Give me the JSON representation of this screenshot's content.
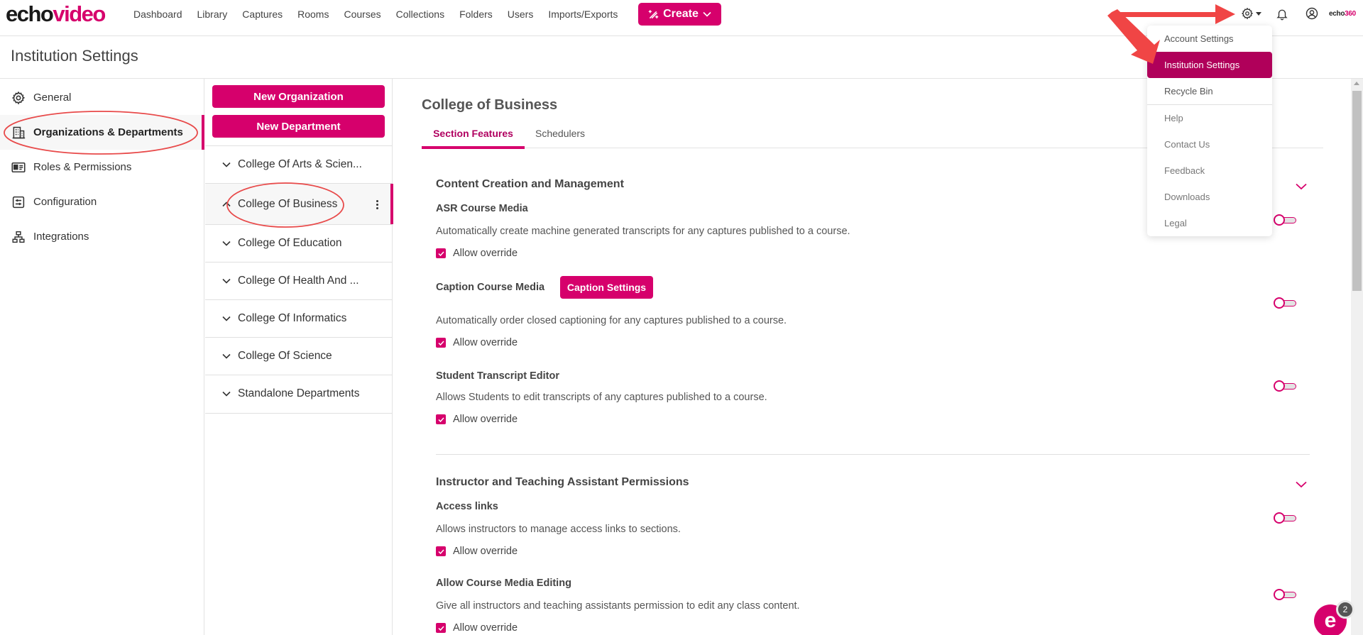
{
  "header": {
    "logo": {
      "part1": "echo",
      "part2": "video"
    },
    "nav": [
      "Dashboard",
      "Library",
      "Captures",
      "Rooms",
      "Courses",
      "Collections",
      "Folders",
      "Users",
      "Imports/Exports"
    ],
    "create_label": "Create",
    "brand_small": {
      "part1": "echo",
      "part2": "360"
    }
  },
  "page": {
    "title": "Institution Settings"
  },
  "sidebar": {
    "items": [
      {
        "label": "General",
        "icon": "gear-icon"
      },
      {
        "label": "Organizations & Departments",
        "icon": "building-icon",
        "active": true
      },
      {
        "label": "Roles & Permissions",
        "icon": "id-card-icon"
      },
      {
        "label": "Configuration",
        "icon": "configuration-icon"
      },
      {
        "label": "Integrations",
        "icon": "network-icon"
      }
    ]
  },
  "orgtree": {
    "new_org_label": "New Organization",
    "new_dept_label": "New Department",
    "items": [
      {
        "label": "College Of Arts & Scien...",
        "expanded": false
      },
      {
        "label": "College Of Business",
        "expanded": true,
        "active": true
      },
      {
        "label": "College Of Education",
        "expanded": false
      },
      {
        "label": "College Of Health And ...",
        "expanded": false
      },
      {
        "label": "College Of Informatics",
        "expanded": false
      },
      {
        "label": "College Of Science",
        "expanded": false
      },
      {
        "label": "Standalone Departments",
        "expanded": false
      }
    ]
  },
  "main": {
    "title": "College of Business",
    "tabs": [
      {
        "label": "Section Features",
        "active": true
      },
      {
        "label": "Schedulers",
        "active": false
      }
    ],
    "sections": [
      {
        "heading": "Content Creation and Management",
        "features": [
          {
            "title": "ASR Course Media",
            "description": "Automatically create machine generated transcripts for any captures published to a course.",
            "override_label": "Allow override",
            "override_checked": true,
            "enabled": false
          },
          {
            "title": "Caption Course Media",
            "button_label": "Caption Settings",
            "description": "Automatically order closed captioning for any captures published to a course.",
            "override_label": "Allow override",
            "override_checked": true,
            "enabled": false
          },
          {
            "title": "Student Transcript Editor",
            "description": "Allows Students to edit transcripts of any captures published to a course.",
            "override_label": "Allow override",
            "override_checked": true,
            "enabled": false
          }
        ]
      },
      {
        "heading": "Instructor and Teaching Assistant Permissions",
        "features": [
          {
            "title": "Access links",
            "description": "Allows instructors to manage access links to sections.",
            "override_label": "Allow override",
            "override_checked": true,
            "enabled": false
          },
          {
            "title": "Allow Course Media Editing",
            "description": "Give all instructors and teaching assistants permission to edit any class content.",
            "override_label": "Allow override",
            "override_checked": true,
            "enabled": false
          }
        ]
      }
    ]
  },
  "settings_menu": {
    "items": [
      {
        "label": "Account Settings"
      },
      {
        "label": "Institution Settings",
        "active": true
      },
      {
        "label": "Recycle Bin"
      },
      {
        "label": "Help"
      },
      {
        "label": "Contact Us"
      },
      {
        "label": "Feedback"
      },
      {
        "label": "Downloads"
      },
      {
        "label": "Legal"
      }
    ]
  },
  "chat": {
    "badge_count": "2",
    "glyph": "e"
  },
  "colors": {
    "accent": "#d6006c",
    "accent_dark": "#b0005a",
    "annotation": "#f04545"
  }
}
